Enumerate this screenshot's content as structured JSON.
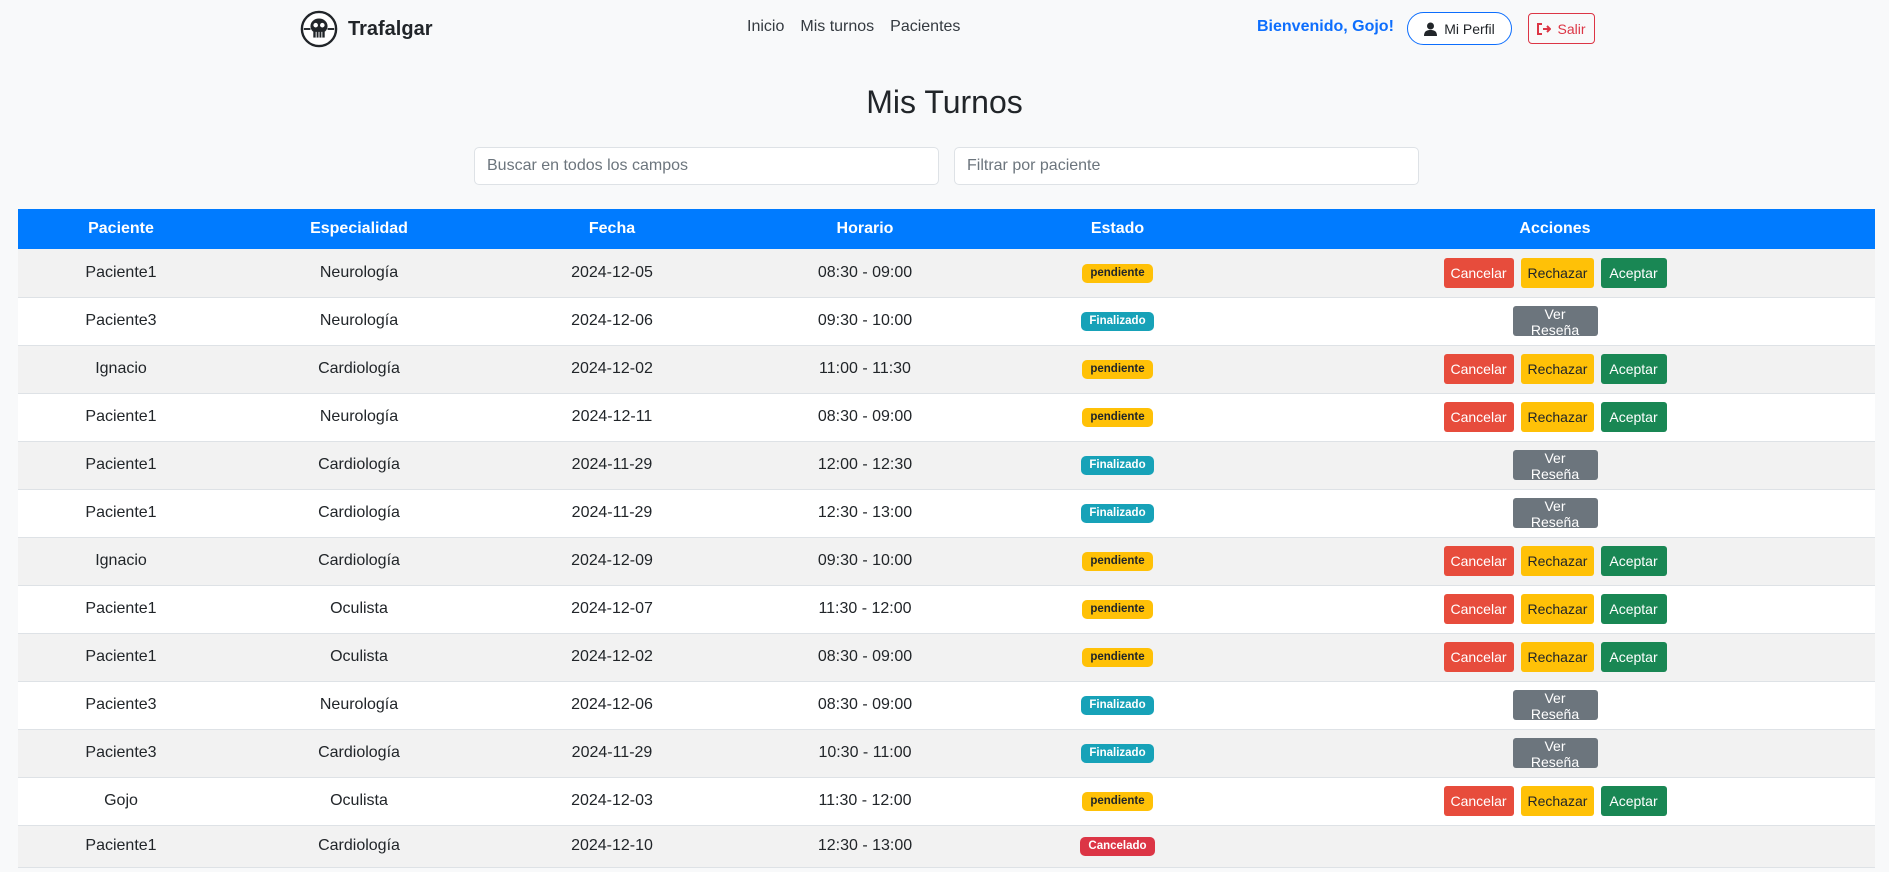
{
  "navbar": {
    "brand": "Trafalgar",
    "links": [
      "Inicio",
      "Mis turnos",
      "Pacientes"
    ],
    "welcome": "Bienvenido, Gojo!",
    "profile_label": "Mi Perfil",
    "logout_label": "Salir"
  },
  "page": {
    "title": "Mis Turnos",
    "search_placeholder": "Buscar en todos los campos",
    "patient_filter_placeholder": "Filtrar por paciente"
  },
  "table": {
    "headers": [
      "Paciente",
      "Especialidad",
      "Fecha",
      "Horario",
      "Estado",
      "Acciones"
    ],
    "action_labels": {
      "cancel": "Cancelar",
      "reject": "Rechazar",
      "accept": "Aceptar",
      "review": "Ver Reseña"
    },
    "rows": [
      {
        "paciente": "Paciente1",
        "especialidad": "Neurología",
        "fecha": "2024-12-05",
        "horario": "08:30 - 09:00",
        "estado": "pendiente"
      },
      {
        "paciente": "Paciente3",
        "especialidad": "Neurología",
        "fecha": "2024-12-06",
        "horario": "09:30 - 10:00",
        "estado": "Finalizado"
      },
      {
        "paciente": "Ignacio",
        "especialidad": "Cardiología",
        "fecha": "2024-12-02",
        "horario": "11:00 - 11:30",
        "estado": "pendiente"
      },
      {
        "paciente": "Paciente1",
        "especialidad": "Neurología",
        "fecha": "2024-12-11",
        "horario": "08:30 - 09:00",
        "estado": "pendiente"
      },
      {
        "paciente": "Paciente1",
        "especialidad": "Cardiología",
        "fecha": "2024-11-29",
        "horario": "12:00 - 12:30",
        "estado": "Finalizado"
      },
      {
        "paciente": "Paciente1",
        "especialidad": "Cardiología",
        "fecha": "2024-11-29",
        "horario": "12:30 - 13:00",
        "estado": "Finalizado"
      },
      {
        "paciente": "Ignacio",
        "especialidad": "Cardiología",
        "fecha": "2024-12-09",
        "horario": "09:30 - 10:00",
        "estado": "pendiente"
      },
      {
        "paciente": "Paciente1",
        "especialidad": "Oculista",
        "fecha": "2024-12-07",
        "horario": "11:30 - 12:00",
        "estado": "pendiente"
      },
      {
        "paciente": "Paciente1",
        "especialidad": "Oculista",
        "fecha": "2024-12-02",
        "horario": "08:30 - 09:00",
        "estado": "pendiente"
      },
      {
        "paciente": "Paciente3",
        "especialidad": "Neurología",
        "fecha": "2024-12-06",
        "horario": "08:30 - 09:00",
        "estado": "Finalizado"
      },
      {
        "paciente": "Paciente3",
        "especialidad": "Cardiología",
        "fecha": "2024-11-29",
        "horario": "10:30 - 11:00",
        "estado": "Finalizado"
      },
      {
        "paciente": "Gojo",
        "especialidad": "Oculista",
        "fecha": "2024-12-03",
        "horario": "11:30 - 12:00",
        "estado": "pendiente"
      },
      {
        "paciente": "Paciente1",
        "especialidad": "Cardiología",
        "fecha": "2024-12-10",
        "horario": "12:30 - 13:00",
        "estado": "Cancelado"
      }
    ]
  },
  "colors": {
    "header_blue": "#007bff",
    "link_blue": "#0d6efd",
    "danger": "#dc3545",
    "warning": "#ffc107",
    "success": "#198754",
    "info": "#17a2b8",
    "secondary": "#6c757d"
  }
}
